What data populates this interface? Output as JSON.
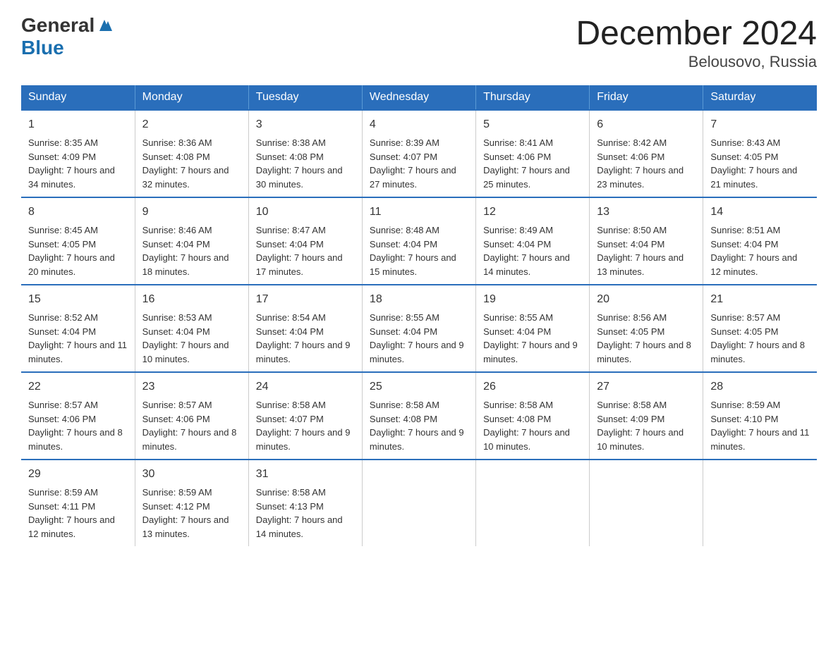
{
  "header": {
    "logo_general": "General",
    "logo_blue": "Blue",
    "title": "December 2024",
    "subtitle": "Belousovo, Russia"
  },
  "days_of_week": [
    "Sunday",
    "Monday",
    "Tuesday",
    "Wednesday",
    "Thursday",
    "Friday",
    "Saturday"
  ],
  "weeks": [
    [
      {
        "num": "1",
        "sunrise": "Sunrise: 8:35 AM",
        "sunset": "Sunset: 4:09 PM",
        "daylight": "Daylight: 7 hours and 34 minutes."
      },
      {
        "num": "2",
        "sunrise": "Sunrise: 8:36 AM",
        "sunset": "Sunset: 4:08 PM",
        "daylight": "Daylight: 7 hours and 32 minutes."
      },
      {
        "num": "3",
        "sunrise": "Sunrise: 8:38 AM",
        "sunset": "Sunset: 4:08 PM",
        "daylight": "Daylight: 7 hours and 30 minutes."
      },
      {
        "num": "4",
        "sunrise": "Sunrise: 8:39 AM",
        "sunset": "Sunset: 4:07 PM",
        "daylight": "Daylight: 7 hours and 27 minutes."
      },
      {
        "num": "5",
        "sunrise": "Sunrise: 8:41 AM",
        "sunset": "Sunset: 4:06 PM",
        "daylight": "Daylight: 7 hours and 25 minutes."
      },
      {
        "num": "6",
        "sunrise": "Sunrise: 8:42 AM",
        "sunset": "Sunset: 4:06 PM",
        "daylight": "Daylight: 7 hours and 23 minutes."
      },
      {
        "num": "7",
        "sunrise": "Sunrise: 8:43 AM",
        "sunset": "Sunset: 4:05 PM",
        "daylight": "Daylight: 7 hours and 21 minutes."
      }
    ],
    [
      {
        "num": "8",
        "sunrise": "Sunrise: 8:45 AM",
        "sunset": "Sunset: 4:05 PM",
        "daylight": "Daylight: 7 hours and 20 minutes."
      },
      {
        "num": "9",
        "sunrise": "Sunrise: 8:46 AM",
        "sunset": "Sunset: 4:04 PM",
        "daylight": "Daylight: 7 hours and 18 minutes."
      },
      {
        "num": "10",
        "sunrise": "Sunrise: 8:47 AM",
        "sunset": "Sunset: 4:04 PM",
        "daylight": "Daylight: 7 hours and 17 minutes."
      },
      {
        "num": "11",
        "sunrise": "Sunrise: 8:48 AM",
        "sunset": "Sunset: 4:04 PM",
        "daylight": "Daylight: 7 hours and 15 minutes."
      },
      {
        "num": "12",
        "sunrise": "Sunrise: 8:49 AM",
        "sunset": "Sunset: 4:04 PM",
        "daylight": "Daylight: 7 hours and 14 minutes."
      },
      {
        "num": "13",
        "sunrise": "Sunrise: 8:50 AM",
        "sunset": "Sunset: 4:04 PM",
        "daylight": "Daylight: 7 hours and 13 minutes."
      },
      {
        "num": "14",
        "sunrise": "Sunrise: 8:51 AM",
        "sunset": "Sunset: 4:04 PM",
        "daylight": "Daylight: 7 hours and 12 minutes."
      }
    ],
    [
      {
        "num": "15",
        "sunrise": "Sunrise: 8:52 AM",
        "sunset": "Sunset: 4:04 PM",
        "daylight": "Daylight: 7 hours and 11 minutes."
      },
      {
        "num": "16",
        "sunrise": "Sunrise: 8:53 AM",
        "sunset": "Sunset: 4:04 PM",
        "daylight": "Daylight: 7 hours and 10 minutes."
      },
      {
        "num": "17",
        "sunrise": "Sunrise: 8:54 AM",
        "sunset": "Sunset: 4:04 PM",
        "daylight": "Daylight: 7 hours and 9 minutes."
      },
      {
        "num": "18",
        "sunrise": "Sunrise: 8:55 AM",
        "sunset": "Sunset: 4:04 PM",
        "daylight": "Daylight: 7 hours and 9 minutes."
      },
      {
        "num": "19",
        "sunrise": "Sunrise: 8:55 AM",
        "sunset": "Sunset: 4:04 PM",
        "daylight": "Daylight: 7 hours and 9 minutes."
      },
      {
        "num": "20",
        "sunrise": "Sunrise: 8:56 AM",
        "sunset": "Sunset: 4:05 PM",
        "daylight": "Daylight: 7 hours and 8 minutes."
      },
      {
        "num": "21",
        "sunrise": "Sunrise: 8:57 AM",
        "sunset": "Sunset: 4:05 PM",
        "daylight": "Daylight: 7 hours and 8 minutes."
      }
    ],
    [
      {
        "num": "22",
        "sunrise": "Sunrise: 8:57 AM",
        "sunset": "Sunset: 4:06 PM",
        "daylight": "Daylight: 7 hours and 8 minutes."
      },
      {
        "num": "23",
        "sunrise": "Sunrise: 8:57 AM",
        "sunset": "Sunset: 4:06 PM",
        "daylight": "Daylight: 7 hours and 8 minutes."
      },
      {
        "num": "24",
        "sunrise": "Sunrise: 8:58 AM",
        "sunset": "Sunset: 4:07 PM",
        "daylight": "Daylight: 7 hours and 9 minutes."
      },
      {
        "num": "25",
        "sunrise": "Sunrise: 8:58 AM",
        "sunset": "Sunset: 4:08 PM",
        "daylight": "Daylight: 7 hours and 9 minutes."
      },
      {
        "num": "26",
        "sunrise": "Sunrise: 8:58 AM",
        "sunset": "Sunset: 4:08 PM",
        "daylight": "Daylight: 7 hours and 10 minutes."
      },
      {
        "num": "27",
        "sunrise": "Sunrise: 8:58 AM",
        "sunset": "Sunset: 4:09 PM",
        "daylight": "Daylight: 7 hours and 10 minutes."
      },
      {
        "num": "28",
        "sunrise": "Sunrise: 8:59 AM",
        "sunset": "Sunset: 4:10 PM",
        "daylight": "Daylight: 7 hours and 11 minutes."
      }
    ],
    [
      {
        "num": "29",
        "sunrise": "Sunrise: 8:59 AM",
        "sunset": "Sunset: 4:11 PM",
        "daylight": "Daylight: 7 hours and 12 minutes."
      },
      {
        "num": "30",
        "sunrise": "Sunrise: 8:59 AM",
        "sunset": "Sunset: 4:12 PM",
        "daylight": "Daylight: 7 hours and 13 minutes."
      },
      {
        "num": "31",
        "sunrise": "Sunrise: 8:58 AM",
        "sunset": "Sunset: 4:13 PM",
        "daylight": "Daylight: 7 hours and 14 minutes."
      },
      {
        "num": "",
        "sunrise": "",
        "sunset": "",
        "daylight": ""
      },
      {
        "num": "",
        "sunrise": "",
        "sunset": "",
        "daylight": ""
      },
      {
        "num": "",
        "sunrise": "",
        "sunset": "",
        "daylight": ""
      },
      {
        "num": "",
        "sunrise": "",
        "sunset": "",
        "daylight": ""
      }
    ]
  ]
}
